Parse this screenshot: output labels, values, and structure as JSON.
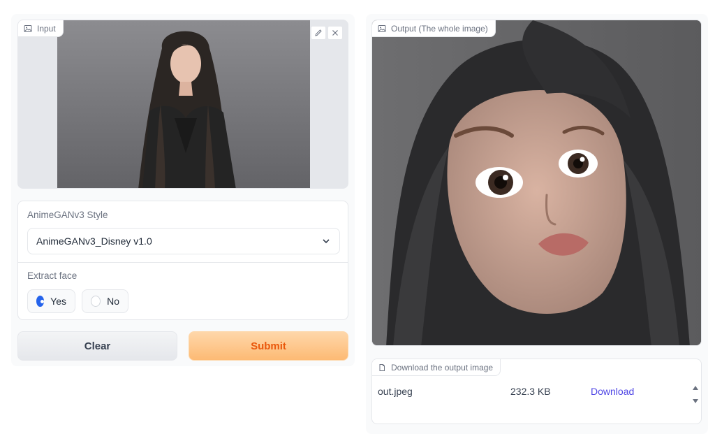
{
  "input": {
    "label": "Input",
    "label_icon": "image-icon",
    "edit_icon": "pencil-icon",
    "close_icon": "close-icon"
  },
  "settings": {
    "style_label": "AnimeGANv3 Style",
    "style_value": "AnimeGANv3_Disney v1.0",
    "face_label": "Extract face",
    "face_options": [
      {
        "label": "Yes",
        "selected": true
      },
      {
        "label": "No",
        "selected": false
      }
    ]
  },
  "actions": {
    "clear_label": "Clear",
    "submit_label": "Submit"
  },
  "output": {
    "label": "Output (The whole image)",
    "label_icon": "image-icon"
  },
  "download": {
    "label": "Download the output image",
    "label_icon": "file-icon",
    "files": [
      {
        "name": "out.jpeg",
        "size": "232.3 KB",
        "link": "Download"
      }
    ]
  },
  "colors": {
    "accent": "#2563eb",
    "submit_text": "#ea580c",
    "submit_bg": "#fdba74",
    "link": "#4f46e5"
  }
}
